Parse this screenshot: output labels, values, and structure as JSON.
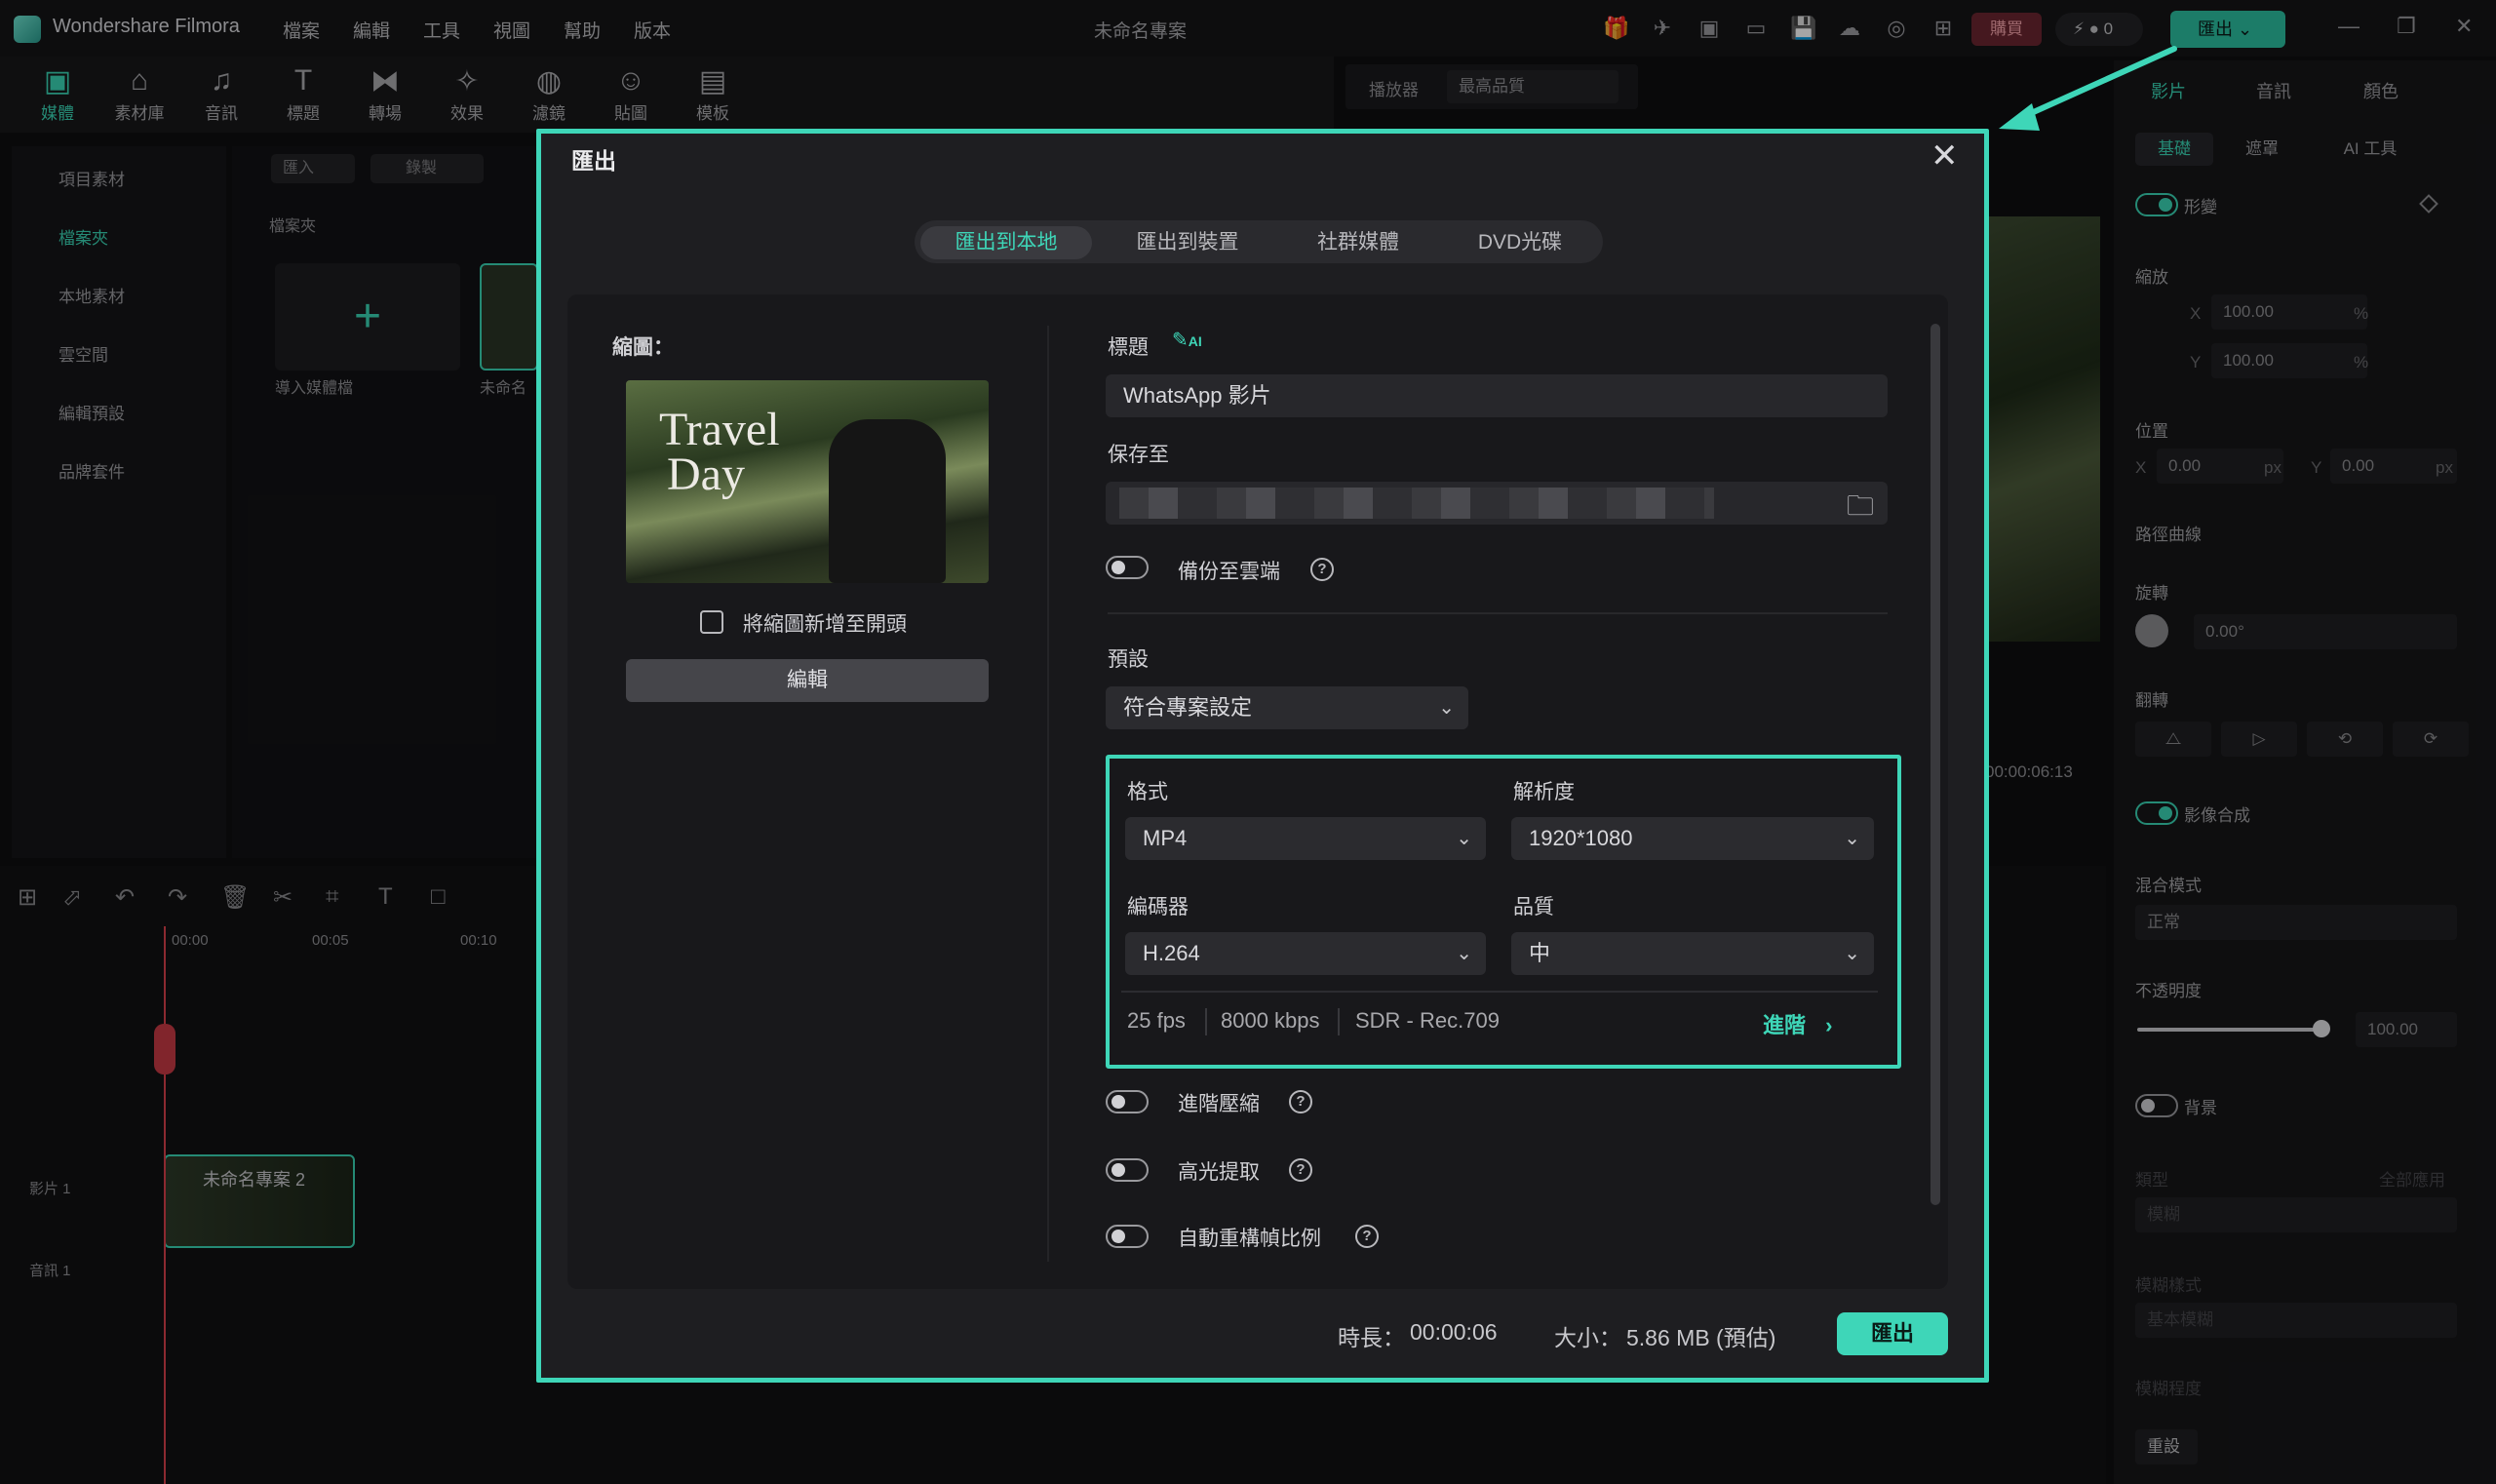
{
  "app": {
    "name": "Wondershare Filmora",
    "project_title": "未命名專案",
    "menu": [
      "檔案",
      "編輯",
      "工具",
      "視圖",
      "幫助",
      "版本"
    ],
    "buy_label": "購買",
    "credits": "0",
    "export_label": "匯出"
  },
  "toolbar": {
    "items": [
      "媒體",
      "素材庫",
      "音訊",
      "標題",
      "轉場",
      "效果",
      "濾鏡",
      "貼圖",
      "模板"
    ]
  },
  "left_panel": {
    "items": [
      "項目素材",
      "檔案夾",
      "本地素材",
      "雲空間",
      "編輯預設",
      "品牌套件"
    ]
  },
  "media_panel": {
    "import_label": "匯入",
    "record_label": "錄製",
    "folder_label": "檔案夾",
    "import_media_caption": "導入媒體檔",
    "project_caption": "未命名"
  },
  "player": {
    "label": "播放器",
    "quality": "最高品質",
    "timecode": "00:00:06:13"
  },
  "right_panel": {
    "tabs": [
      "影片",
      "音訊",
      "顏色"
    ],
    "subtabs": [
      "基礎",
      "遮罩",
      "AI 工具"
    ],
    "transform_label": "形變",
    "scale_label": "縮放",
    "x_label": "X",
    "y_label": "Y",
    "scale_x": "100.00",
    "scale_y": "100.00",
    "percent": "%",
    "position_label": "位置",
    "pos_x": "0.00",
    "pos_y": "0.00",
    "px": "px",
    "path_curve_label": "路徑曲線",
    "rotate_label": "旋轉",
    "rotate_value": "0.00°",
    "flip_label": "翻轉",
    "composite_label": "影像合成",
    "blend_label": "混合模式",
    "blend_value": "正常",
    "opacity_label": "不透明度",
    "opacity_value": "100.00",
    "background_label": "背景",
    "type_label": "類型",
    "apply_all_label": "全部應用",
    "type_value": "模糊",
    "blur_style_label": "模糊樣式",
    "blur_style_value": "基本模糊",
    "blur_level_label": "模糊程度",
    "reset_label": "重設"
  },
  "timeline": {
    "ticks": [
      "00:00",
      "00:05",
      "00:10"
    ],
    "video_track": "影片 1",
    "audio_track": "音訊 1",
    "clip_name": "未命名專案 2"
  },
  "modal": {
    "title": "匯出",
    "tabs": [
      "匯出到本地",
      "匯出到裝置",
      "社群媒體",
      "DVD光碟"
    ],
    "thumbnail_label": "縮圖：",
    "thumb_text_line1": "Travel",
    "thumb_text_line2": "Day",
    "add_thumb_label": "將縮圖新增至開頭",
    "edit_label": "編輯",
    "title_label": "標題",
    "ai_badge": "AI",
    "title_value": "WhatsApp 影片",
    "save_to_label": "保存至",
    "backup_label": "備份至雲端",
    "preset_label": "預設",
    "preset_value": "符合專案設定",
    "format_label": "格式",
    "format_value": "MP4",
    "resolution_label": "解析度",
    "resolution_value": "1920*1080",
    "encoder_label": "編碼器",
    "encoder_value": "H.264",
    "quality_label": "品質",
    "quality_value": "中",
    "fps": "25 fps",
    "bitrate": "8000 kbps",
    "color": "SDR - Rec.709",
    "advanced_label": "進階",
    "adv_compress_label": "進階壓縮",
    "highlight_label": "高光提取",
    "auto_reframe_label": "自動重構幀比例",
    "duration_label": "時長：",
    "duration_value": "00:00:06",
    "size_label": "大小：",
    "size_value": "5.86 MB (預估)",
    "export_button": "匯出"
  },
  "colors": {
    "accent": "#3ed6b8",
    "modal_bg": "#1e1e21",
    "buy": "#6b2630"
  }
}
